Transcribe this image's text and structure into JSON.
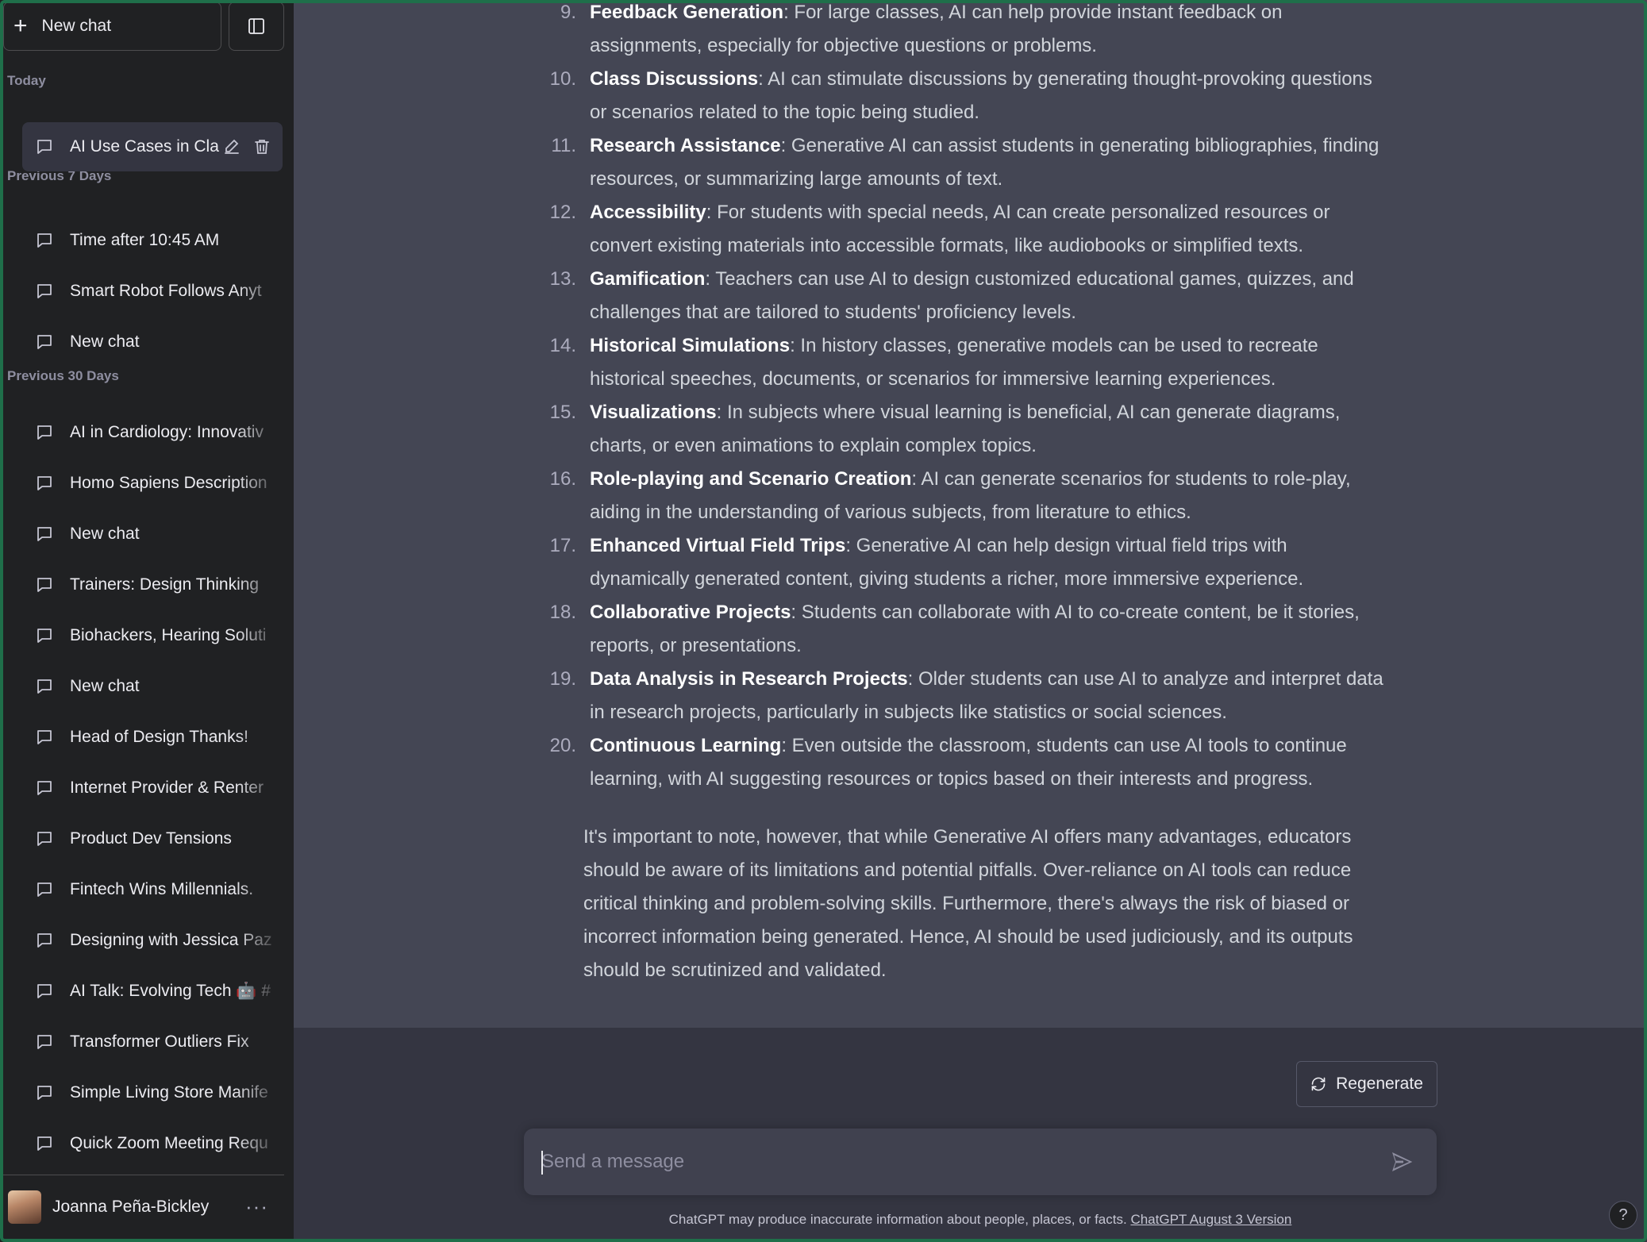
{
  "sidebar": {
    "new_chat_label": "New chat",
    "sections": [
      {
        "label": "Today"
      },
      {
        "label": "Previous 7 Days"
      },
      {
        "label": "Previous 30 Days"
      }
    ],
    "items": [
      "AI Use Cases in Cla",
      "Time after 10:45 AM",
      "Smart Robot Follows Anyt",
      "New chat",
      "AI in Cardiology: Innovativ",
      "Homo Sapiens Description",
      "New chat",
      "Trainers: Design Thinking",
      "Biohackers, Hearing Soluti",
      "New chat",
      "Head of Design Thanks!",
      "Internet Provider & Renter",
      "Product Dev Tensions",
      "Fintech Wins Millennials.",
      "Designing with Jessica Paz",
      "AI Talk: Evolving Tech 🤖 #",
      "Transformer Outliers Fix",
      "Simple Living Store Manife",
      "Quick Zoom Meeting Requ"
    ],
    "user_name": "Joanna Peña-Bickley",
    "more_label": "···"
  },
  "conversation": {
    "list": [
      {
        "num": "9.",
        "title": "Feedback Generation",
        "text": ": For large classes, AI can help provide instant feedback on assignments, especially for objective questions or problems."
      },
      {
        "num": "10.",
        "title": "Class Discussions",
        "text": ": AI can stimulate discussions by generating thought-provoking questions or scenarios related to the topic being studied."
      },
      {
        "num": "11.",
        "title": "Research Assistance",
        "text": ": Generative AI can assist students in generating bibliographies, finding resources, or summarizing large amounts of text."
      },
      {
        "num": "12.",
        "title": "Accessibility",
        "text": ": For students with special needs, AI can create personalized resources or convert existing materials into accessible formats, like audiobooks or simplified texts."
      },
      {
        "num": "13.",
        "title": "Gamification",
        "text": ": Teachers can use AI to design customized educational games, quizzes, and challenges that are tailored to students' proficiency levels."
      },
      {
        "num": "14.",
        "title": "Historical Simulations",
        "text": ": In history classes, generative models can be used to recreate historical speeches, documents, or scenarios for immersive learning experiences."
      },
      {
        "num": "15.",
        "title": "Visualizations",
        "text": ": In subjects where visual learning is beneficial, AI can generate diagrams, charts, or even animations to explain complex topics."
      },
      {
        "num": "16.",
        "title": "Role-playing and Scenario Creation",
        "text": ": AI can generate scenarios for students to role-play, aiding in the understanding of various subjects, from literature to ethics."
      },
      {
        "num": "17.",
        "title": "Enhanced Virtual Field Trips",
        "text": ": Generative AI can help design virtual field trips with dynamically generated content, giving students a richer, more immersive experience."
      },
      {
        "num": "18.",
        "title": "Collaborative Projects",
        "text": ": Students can collaborate with AI to co-create content, be it stories, reports, or presentations."
      },
      {
        "num": "19.",
        "title": "Data Analysis in Research Projects",
        "text": ": Older students can use AI to analyze and interpret data in research projects, particularly in subjects like statistics or social sciences."
      },
      {
        "num": "20.",
        "title": "Continuous Learning",
        "text": ": Even outside the classroom, students can use AI tools to continue learning, with AI suggesting resources or topics based on their interests and progress."
      }
    ],
    "closing": "It's important to note, however, that while Generative AI offers many advantages, educators should be aware of its limitations and potential pitfalls. Over-reliance on AI tools can reduce critical thinking and problem-solving skills. Furthermore, there's always the risk of biased or incorrect information being generated. Hence, AI should be used judiciously, and its outputs should be scrutinized and validated."
  },
  "composer": {
    "regenerate_label": "Regenerate",
    "placeholder": "Send a message",
    "disclaimer": "ChatGPT may produce inaccurate information about people, places, or facts.",
    "version_link": "ChatGPT August 3 Version",
    "help_label": "?"
  },
  "colors": {
    "sidebar_bg": "#202123",
    "main_bg": "#444654",
    "composer_bg": "#343541",
    "frame_accent": "#1f6f4a"
  }
}
